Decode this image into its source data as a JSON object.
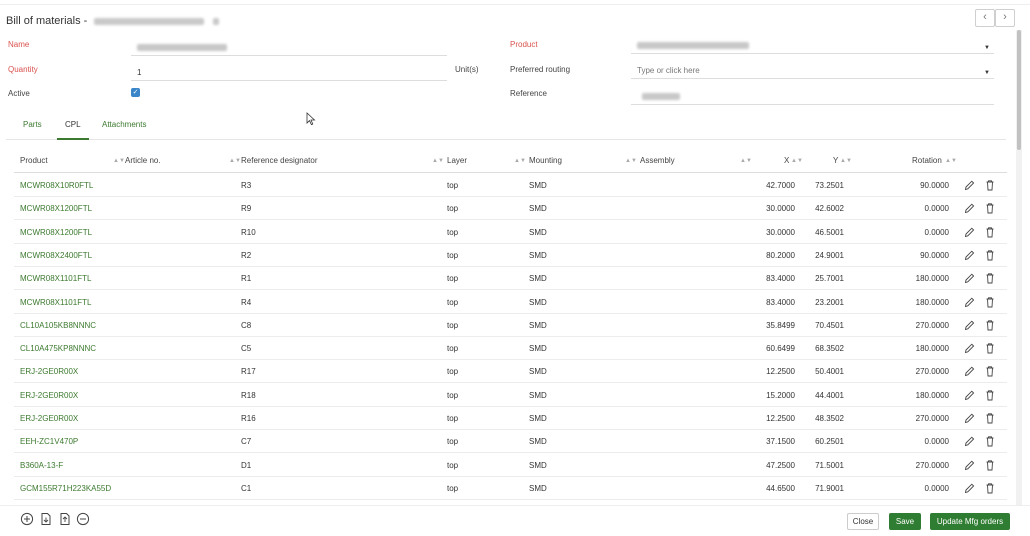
{
  "dialog": {
    "title": "Bill of materials -"
  },
  "form": {
    "name_label": "Name",
    "quantity_label": "Quantity",
    "quantity_value": "1",
    "unit_label": "Unit(s)",
    "active_label": "Active",
    "product_label": "Product",
    "preferred_routing_label": "Preferred routing",
    "preferred_routing_placeholder": "Type or click here",
    "reference_label": "Reference"
  },
  "tabs": [
    "Parts",
    "CPL",
    "Attachments"
  ],
  "table": {
    "headers": {
      "product": "Product",
      "article": "Article no.",
      "refdes": "Reference designator",
      "layer": "Layer",
      "mounting": "Mounting",
      "assembly": "Assembly",
      "x": "X",
      "y": "Y",
      "rotation": "Rotation"
    },
    "rows": [
      {
        "product": "MCWR08X10R0FTL",
        "refdes": "R3",
        "layer": "top",
        "mounting": "SMD",
        "x": "42.7000",
        "y": "73.2501",
        "rotation": "90.0000"
      },
      {
        "product": "MCWR08X1200FTL",
        "refdes": "R9",
        "layer": "top",
        "mounting": "SMD",
        "x": "30.0000",
        "y": "42.6002",
        "rotation": "0.0000"
      },
      {
        "product": "MCWR08X1200FTL",
        "refdes": "R10",
        "layer": "top",
        "mounting": "SMD",
        "x": "30.0000",
        "y": "46.5001",
        "rotation": "0.0000"
      },
      {
        "product": "MCWR08X2400FTL",
        "refdes": "R2",
        "layer": "top",
        "mounting": "SMD",
        "x": "80.2000",
        "y": "24.9001",
        "rotation": "90.0000"
      },
      {
        "product": "MCWR08X1101FTL",
        "refdes": "R1",
        "layer": "top",
        "mounting": "SMD",
        "x": "83.4000",
        "y": "25.7001",
        "rotation": "180.0000"
      },
      {
        "product": "MCWR08X1101FTL",
        "refdes": "R4",
        "layer": "top",
        "mounting": "SMD",
        "x": "83.4000",
        "y": "23.2001",
        "rotation": "180.0000"
      },
      {
        "product": "CL10A105KB8NNNC",
        "refdes": "C8",
        "layer": "top",
        "mounting": "SMD",
        "x": "35.8499",
        "y": "70.4501",
        "rotation": "270.0000"
      },
      {
        "product": "CL10A475KP8NNNC",
        "refdes": "C5",
        "layer": "top",
        "mounting": "SMD",
        "x": "60.6499",
        "y": "68.3502",
        "rotation": "180.0000"
      },
      {
        "product": "ERJ-2GE0R00X",
        "refdes": "R17",
        "layer": "top",
        "mounting": "SMD",
        "x": "12.2500",
        "y": "50.4001",
        "rotation": "270.0000"
      },
      {
        "product": "ERJ-2GE0R00X",
        "refdes": "R18",
        "layer": "top",
        "mounting": "SMD",
        "x": "15.2000",
        "y": "44.4001",
        "rotation": "180.0000"
      },
      {
        "product": "ERJ-2GE0R00X",
        "refdes": "R16",
        "layer": "top",
        "mounting": "SMD",
        "x": "12.2500",
        "y": "48.3502",
        "rotation": "270.0000"
      },
      {
        "product": "EEH-ZC1V470P",
        "refdes": "C7",
        "layer": "top",
        "mounting": "SMD",
        "x": "37.1500",
        "y": "60.2501",
        "rotation": "0.0000"
      },
      {
        "product": "B360A-13-F",
        "refdes": "D1",
        "layer": "top",
        "mounting": "SMD",
        "x": "47.2500",
        "y": "71.5001",
        "rotation": "270.0000"
      },
      {
        "product": "GCM155R71H223KA55D",
        "refdes": "C1",
        "layer": "top",
        "mounting": "SMD",
        "x": "44.6500",
        "y": "71.9001",
        "rotation": "0.0000"
      }
    ]
  },
  "footer": {
    "close_label": "Close",
    "save_label": "Save",
    "update_label": "Update Mfg orders"
  },
  "colors": {
    "link_green": "#3c7a2f",
    "primary_button": "#2f7d32",
    "required_label": "#d9534f",
    "checkbox_blue": "#3a86c8"
  }
}
